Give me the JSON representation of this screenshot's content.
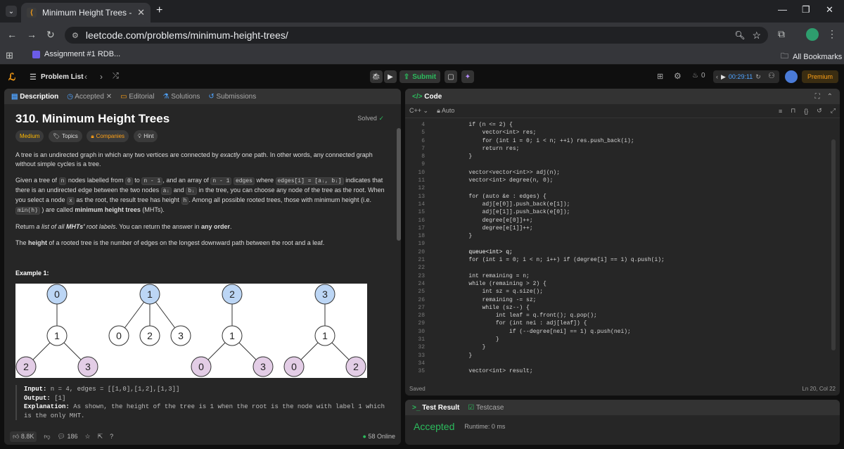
{
  "browser": {
    "tab_title": "Minimum Height Trees - LeetCo",
    "url": "leetcode.com/problems/minimum-height-trees/",
    "bookmark": "Assignment #1 RDB...",
    "all_bookmarks": "All Bookmarks"
  },
  "nav": {
    "problem_list": "Problem List",
    "submit": "Submit",
    "streak": "0",
    "timer": "00:29:11",
    "premium": "Premium"
  },
  "desc_tabs": [
    "Description",
    "Accepted",
    "Editorial",
    "Solutions",
    "Submissions"
  ],
  "problem": {
    "title": "310. Minimum Height Trees",
    "status": "Solved",
    "chips": [
      "Medium",
      "Topics",
      "Companies",
      "Hint"
    ],
    "p1a": "A tree is an undirected graph in which any two vertices are connected by ",
    "p1b": "exactly",
    "p1c": " one path. In other words, any connected graph without simple cycles is a tree.",
    "p2_line1": "Given a tree of",
    "code_n": "n",
    "p2_nodes": "nodes labelled from",
    "code_0": "0",
    "p2_to": "to",
    "code_n1": "n - 1",
    "p2_array": ", and an array of",
    "code_edges_len": "n - 1",
    "code_edges": "edges",
    "p2_where": "where",
    "code_ei": "edges[i] = [aᵢ, bᵢ]",
    "p2_indicates": "indicates that there is an undirected edge between the two nodes",
    "code_ai": "aᵢ",
    "p2_and": "and",
    "code_bi": "bᵢ",
    "p2_rest": "in the tree, you can choose any node of the tree as the root. When you select a node",
    "code_x": "x",
    "p2_root": "as the root, the result tree has height",
    "code_h": "h",
    "p2_among": ". Among all possible rooted trees, those with minimum height (i.e.",
    "code_minh": "min(h)",
    "p2_called": ") are called",
    "p2_mht": "minimum height trees",
    "p2_mhtend": " (MHTs).",
    "p3a": "Return ",
    "p3b": "a list of all ",
    "p3c": "MHTs'",
    "p3d": " root labels",
    "p3e": ". You can return the answer in ",
    "p3f": "any order",
    "p3g": ".",
    "p4a": "The ",
    "p4b": "height",
    "p4c": " of a rooted tree is the number of edges on the longest downward path between the root and a leaf.",
    "example_title": "Example 1:",
    "input_label": "Input:",
    "input_val": " n = 4, edges = [[1,0],[1,2],[1,3]]",
    "output_label": "Output:",
    "output_val": " [1]",
    "expl_label": "Explanation:",
    "expl_val": " As shown, the height of the tree is 1 when the root is the node with label 1 which is the only MHT."
  },
  "trees": [
    {
      "root": "0",
      "mid": "1",
      "leaves": [
        "2",
        "3"
      ]
    },
    {
      "root": "1",
      "leaves": [
        "0",
        "2",
        "3"
      ]
    },
    {
      "root": "2",
      "mid": "1",
      "leaves": [
        "0",
        "3"
      ]
    },
    {
      "root": "3",
      "mid": "1",
      "leaves": [
        "0",
        "2"
      ]
    }
  ],
  "footer": {
    "likes": "8.8K",
    "comments": "186",
    "online": "58 Online"
  },
  "code_panel": {
    "title": "Code",
    "lang": "C++",
    "auto": "Auto",
    "saved": "Saved",
    "cursor": "Ln 20, Col 22"
  },
  "code_lines": [
    {
      "n": "4",
      "t": "        if (n <= 2) {"
    },
    {
      "n": "5",
      "t": "            vector<int> res;"
    },
    {
      "n": "6",
      "t": "            for (int i = 0; i < n; ++i) res.push_back(i);"
    },
    {
      "n": "7",
      "t": "            return res;"
    },
    {
      "n": "8",
      "t": "        }"
    },
    {
      "n": "9",
      "t": ""
    },
    {
      "n": "10",
      "t": "        vector<vector<int>> adj(n);"
    },
    {
      "n": "11",
      "t": "        vector<int> degree(n, 0);"
    },
    {
      "n": "12",
      "t": ""
    },
    {
      "n": "13",
      "t": "        for (auto &e : edges) {"
    },
    {
      "n": "14",
      "t": "            adj[e[0]].push_back(e[1]);"
    },
    {
      "n": "15",
      "t": "            adj[e[1]].push_back(e[0]);"
    },
    {
      "n": "16",
      "t": "            degree[e[0]]++;"
    },
    {
      "n": "17",
      "t": "            degree[e[1]]++;"
    },
    {
      "n": "18",
      "t": "        }"
    },
    {
      "n": "19",
      "t": ""
    },
    {
      "n": "20",
      "t": "        queue<int> q;"
    },
    {
      "n": "21",
      "t": "        for (int i = 0; i < n; i++) if (degree[i] == 1) q.push(i);"
    },
    {
      "n": "22",
      "t": ""
    },
    {
      "n": "23",
      "t": "        int remaining = n;"
    },
    {
      "n": "24",
      "t": "        while (remaining > 2) {"
    },
    {
      "n": "25",
      "t": "            int sz = q.size();"
    },
    {
      "n": "26",
      "t": "            remaining -= sz;"
    },
    {
      "n": "27",
      "t": "            while (sz--) {"
    },
    {
      "n": "28",
      "t": "                int leaf = q.front(); q.pop();"
    },
    {
      "n": "29",
      "t": "                for (int nei : adj[leaf]) {"
    },
    {
      "n": "30",
      "t": "                    if (--degree[nei] == 1) q.push(nei);"
    },
    {
      "n": "31",
      "t": "                }"
    },
    {
      "n": "32",
      "t": "            }"
    },
    {
      "n": "33",
      "t": "        }"
    },
    {
      "n": "34",
      "t": ""
    },
    {
      "n": "35",
      "t": "        vector<int> result;"
    }
  ],
  "result": {
    "tab_result": "Test Result",
    "tab_testcase": "Testcase",
    "status": "Accepted",
    "runtime": "Runtime: 0 ms"
  }
}
